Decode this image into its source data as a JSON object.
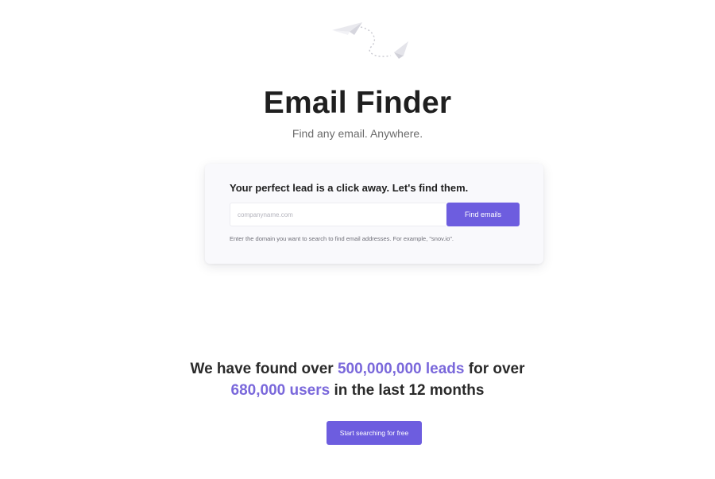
{
  "hero": {
    "title": "Email Finder",
    "subtitle": "Find any email. Anywhere."
  },
  "search": {
    "heading": "Your perfect lead is a click away. Let's find them.",
    "placeholder": "companyname.com",
    "value": "",
    "button_label": "Find emails",
    "helper_text": "Enter the domain you want to search to find email addresses. For example, \"snov.io\"."
  },
  "stats": {
    "line1_prefix": "We have found over ",
    "line1_highlight": "500,000,000 leads",
    "line1_suffix": " for over",
    "line2_highlight": "680,000 users",
    "line2_suffix": " in the last 12 months",
    "highlight_color": "#7a68db"
  },
  "cta": {
    "label": "Start searching for free"
  },
  "decoration": {
    "icon": "paper-plane-icon"
  },
  "colors": {
    "accent": "#6d5ddf",
    "card_background": "#f9f9fc"
  }
}
